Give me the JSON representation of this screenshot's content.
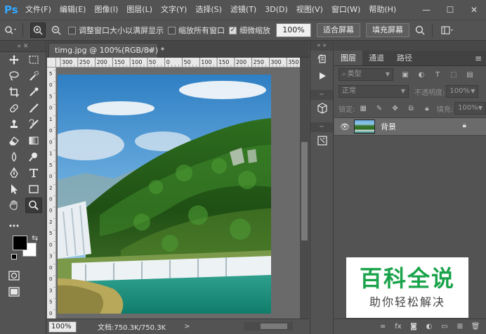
{
  "app": {
    "logo": "Ps"
  },
  "menu": [
    "文件(F)",
    "编辑(E)",
    "图像(I)",
    "图层(L)",
    "文字(Y)",
    "选择(S)",
    "滤镜(T)",
    "3D(D)",
    "视图(V)",
    "窗口(W)",
    "帮助(H)"
  ],
  "window_controls": {
    "minimize": "—",
    "maximize": "☐",
    "close": "✕"
  },
  "options": {
    "resize_windows_label": "调整窗口大小以满屏显示",
    "resize_windows_checked": false,
    "zoom_all_label": "缩放所有窗口",
    "zoom_all_checked": false,
    "scrubby_zoom_label": "细微缩放",
    "scrubby_zoom_checked": true,
    "zoom_value": "100%",
    "fit_screen_label": "适合屏幕",
    "fill_screen_label": "填充屏幕"
  },
  "document": {
    "tab_title": "timg.jpg @ 100%(RGB/8#) *",
    "tab_close": "×",
    "ruler_top": [
      "300",
      "250",
      "200",
      "150",
      "100",
      "50",
      "0",
      "50",
      "100",
      "150",
      "200",
      "250",
      "300",
      "350"
    ],
    "ruler_left": [
      "5",
      "0",
      "5",
      "0",
      "1",
      "0",
      "0",
      "1",
      "5",
      "0",
      "2",
      "0",
      "0",
      "2",
      "5",
      "0",
      "3",
      "0",
      "0",
      "3",
      "5",
      "0"
    ],
    "status_zoom": "100%",
    "status_info": "文档:750.3K/750.3K",
    "status_arrow": ">"
  },
  "layers_panel": {
    "tabs": [
      "图层",
      "通道",
      "路径"
    ],
    "active_tab": "图层",
    "filter_kind": "类型",
    "blend_mode": "正常",
    "opacity_label": "不透明度:",
    "opacity_value": "100%",
    "lock_label": "锁定:",
    "fill_label": "填充:",
    "fill_value": "100%",
    "layer_name": "背景"
  },
  "watermark": {
    "title": "百科全说",
    "subtitle": "助你轻松解决"
  },
  "colors": {
    "ps_blue": "#31a8ff",
    "foreground": "#000000",
    "background": "#ffffff",
    "watermark_green": "#1aa34a"
  }
}
